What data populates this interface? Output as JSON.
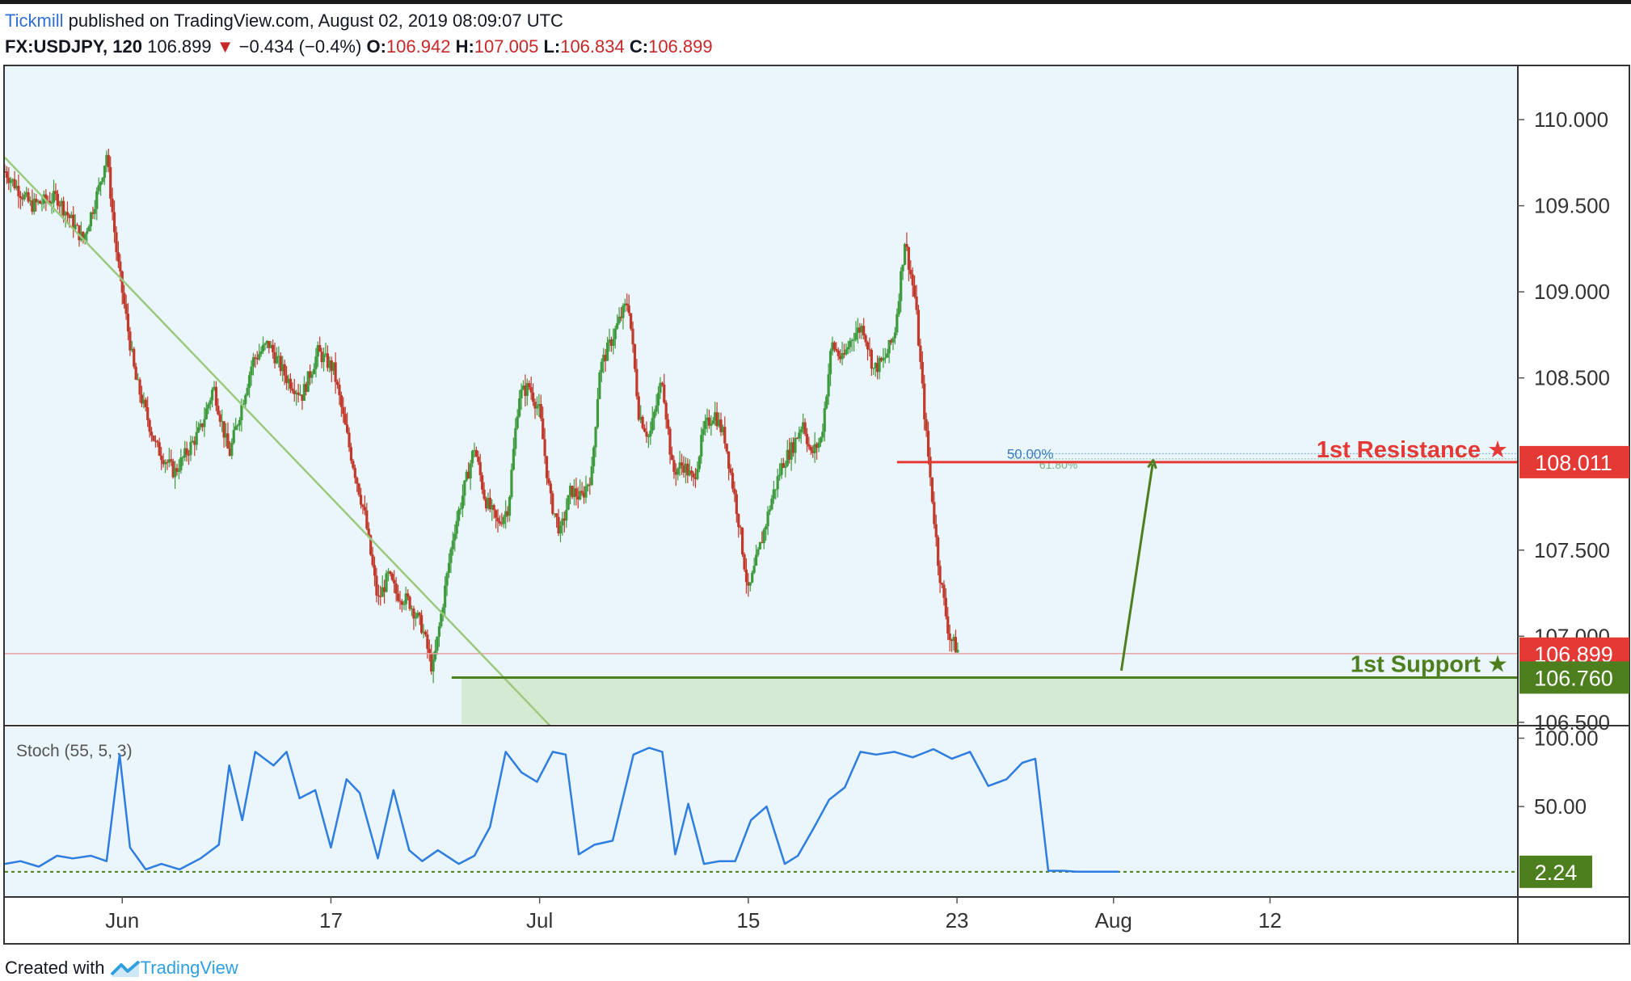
{
  "header": {
    "brand": "Tickmill",
    "published_text": " published on TradingView.com, August 02, 2019 08:09:07 UTC",
    "symbol": "FX:USDJPY, 120",
    "last": "106.899",
    "change": "−0.434 (−0.4%)",
    "open_label": "O:",
    "open": "106.942",
    "high_label": "H:",
    "high": "107.005",
    "low_label": "L:",
    "low": "106.834",
    "close_label": "C:",
    "close": "106.899"
  },
  "footer": {
    "created_with": "Created with",
    "brand": "TradingView"
  },
  "colors": {
    "background": "#eaf6fb",
    "resistance": "#e53935",
    "support": "#4e7f1f",
    "support_zone": "#d4ead3",
    "trendline": "#9cc97e",
    "stoch_line": "#2e7de0",
    "candle_up": "#3d9a3d",
    "candle_down": "#c0392b"
  },
  "chart_data": {
    "type": "candlestick",
    "symbol": "FX:USDJPY",
    "timeframe": "120",
    "price_axis": {
      "ticks": [
        "110.000",
        "109.500",
        "109.000",
        "108.500",
        "107.500",
        "107.000",
        "106.500"
      ],
      "ylim": [
        106.49,
        110.31
      ]
    },
    "time_axis": {
      "ticks": [
        "Jun",
        "17",
        "Jul",
        "15",
        "23",
        "Aug",
        "12"
      ],
      "x": [
        34.5,
        42.5,
        50.5,
        58.5,
        66.5,
        72.5,
        78.5
      ],
      "xlim": [
        30,
        88
      ]
    },
    "price_path_x": [
      30.0,
      31.0,
      32.0,
      33.0,
      33.6,
      33.9,
      34.3,
      35.0,
      35.8,
      36.5,
      37.5,
      38.0,
      38.6,
      39.5,
      40.1,
      40.8,
      41.4,
      42.0,
      42.6,
      43.2,
      43.8,
      44.3,
      44.7,
      45.0,
      45.5,
      46.0,
      46.4,
      46.8,
      47.2,
      47.6,
      48.0,
      48.4,
      48.9,
      49.3,
      49.7,
      50.1,
      50.5,
      50.9,
      51.3,
      51.7,
      52.1,
      52.5,
      52.8,
      53.2,
      53.6,
      53.9,
      54.3,
      54.7,
      55.2,
      55.6,
      56.0,
      56.4,
      56.8,
      57.2,
      57.6,
      58.1,
      58.5,
      59.0,
      59.4,
      59.8,
      60.2,
      60.6,
      60.9,
      61.3,
      61.7,
      62.1,
      62.5,
      62.9,
      63.3,
      63.7,
      64.1,
      64.5,
      64.9,
      65.3,
      65.8,
      66.2,
      66.6,
      67.0,
      67.4,
      67.7,
      68.1,
      68.5,
      69.0,
      69.4,
      69.8,
      70.2,
      70.6,
      71.0,
      71.3,
      71.7,
      72.0,
      72.3,
      72.5,
      72.9
    ],
    "price_path_close": [
      109.7,
      109.5,
      109.55,
      109.3,
      109.6,
      109.8,
      109.2,
      108.5,
      108.1,
      107.95,
      108.2,
      108.45,
      108.05,
      108.6,
      108.7,
      108.5,
      108.4,
      108.65,
      108.55,
      108.1,
      107.7,
      107.2,
      107.35,
      107.25,
      107.2,
      107.05,
      106.8,
      107.2,
      107.6,
      107.85,
      108.1,
      107.8,
      107.65,
      107.75,
      108.4,
      108.45,
      108.3,
      107.8,
      107.6,
      107.85,
      107.8,
      107.95,
      108.55,
      108.7,
      108.85,
      108.95,
      108.3,
      108.15,
      108.5,
      107.95,
      108.0,
      107.9,
      108.2,
      108.3,
      108.15,
      107.7,
      107.25,
      107.55,
      107.8,
      108.0,
      108.1,
      108.25,
      108.05,
      108.15,
      108.7,
      108.6,
      108.75,
      108.8,
      108.55,
      108.6,
      108.75,
      109.3,
      108.95,
      108.2,
      107.4,
      107.0,
      106.899
    ],
    "levels": [
      {
        "name": "1st Resistance ★",
        "value": 108.011,
        "label": "108.011",
        "from_x": 64.2
      },
      {
        "name": "1st Support ★",
        "value": 106.76,
        "label": "106.760",
        "from_x": 47.5
      }
    ],
    "last_price": {
      "value": 106.899,
      "label": "106.899"
    },
    "fib": {
      "label": "50.00%",
      "value": 108.06,
      "secondary_label": "61.80%",
      "secondary_value": 108.03
    },
    "trendline": {
      "from": [
        30.0,
        109.78
      ],
      "to": [
        50.9,
        106.48
      ]
    },
    "projection_arrow": {
      "from": [
        72.8,
        106.8
      ],
      "to": [
        74.0,
        108.0
      ]
    },
    "stoch": {
      "label": "Stoch (55, 5, 3)",
      "ticks": [
        "100.00",
        "50.00"
      ],
      "ylim": [
        -15,
        108
      ],
      "current": 2.24,
      "current_label": "2.24",
      "x": [
        30.0,
        30.6,
        31.3,
        32.0,
        32.6,
        33.3,
        33.9,
        34.4,
        34.8,
        35.4,
        36.0,
        36.7,
        37.5,
        38.2,
        38.6,
        39.1,
        39.6,
        40.3,
        40.8,
        41.3,
        41.9,
        42.5,
        43.1,
        43.6,
        44.3,
        44.9,
        45.5,
        46.0,
        46.6,
        47.4,
        48.0,
        48.6,
        49.2,
        49.8,
        50.4,
        51.0,
        51.5,
        52.0,
        52.6,
        53.3,
        54.1,
        54.7,
        55.2,
        55.7,
        56.2,
        56.8,
        57.4,
        58.0,
        58.6,
        59.2,
        59.9,
        60.4,
        61.0,
        61.6,
        62.2,
        62.8,
        63.4,
        64.1,
        64.8,
        65.6,
        66.3,
        67.0,
        67.7,
        68.4,
        69.0,
        69.5,
        70.0,
        70.6,
        71.1,
        71.5,
        71.9,
        72.4,
        72.7
      ],
      "values": [
        8,
        10,
        6,
        14,
        12,
        14,
        10,
        88,
        20,
        4,
        8,
        4,
        12,
        22,
        80,
        40,
        90,
        80,
        90,
        56,
        62,
        20,
        70,
        60,
        12,
        62,
        18,
        10,
        18,
        8,
        14,
        35,
        90,
        75,
        68,
        90,
        88,
        15,
        22,
        25,
        88,
        93,
        90,
        15,
        52,
        8,
        10,
        10,
        40,
        50,
        8,
        14,
        34,
        55,
        64,
        90,
        88,
        90,
        86,
        92,
        85,
        90,
        65,
        70,
        82,
        85,
        3,
        3,
        2.24,
        2.24,
        2.24,
        2.24,
        2.24
      ]
    }
  }
}
